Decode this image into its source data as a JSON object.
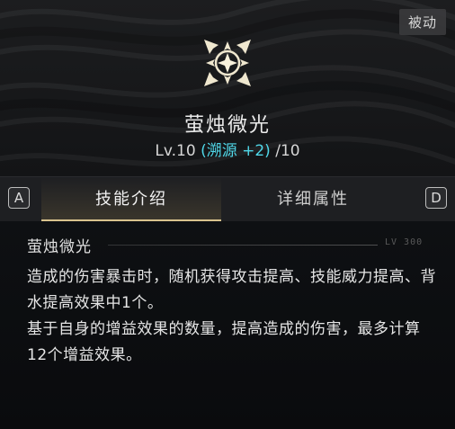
{
  "skill": {
    "type_tag": "被动",
    "name": "萤烛微光",
    "level_prefix": "Lv.10",
    "level_bonus": "(溯源 +2)",
    "level_max": "/10",
    "emblem_icon": "four-point-star-emblem-icon"
  },
  "tabs": {
    "left_key": "A",
    "right_key": "D",
    "items": [
      {
        "label": "技能介绍",
        "active": true
      },
      {
        "label": "详细属性",
        "active": false
      }
    ]
  },
  "content": {
    "section_title": "萤烛微光",
    "section_deco": "LV 300",
    "paragraphs": [
      "造成的伤害暴击时，随机获得攻击提高、技能威力提高、背水提高效果中1个。",
      "基于自身的增益效果的数量，提高造成的伤害，最多计算12个增益效果。"
    ]
  },
  "colors": {
    "accent_gold": "#d9c38e",
    "bonus_cyan": "#4fd7e8",
    "emblem_cream": "#efe7cf"
  }
}
